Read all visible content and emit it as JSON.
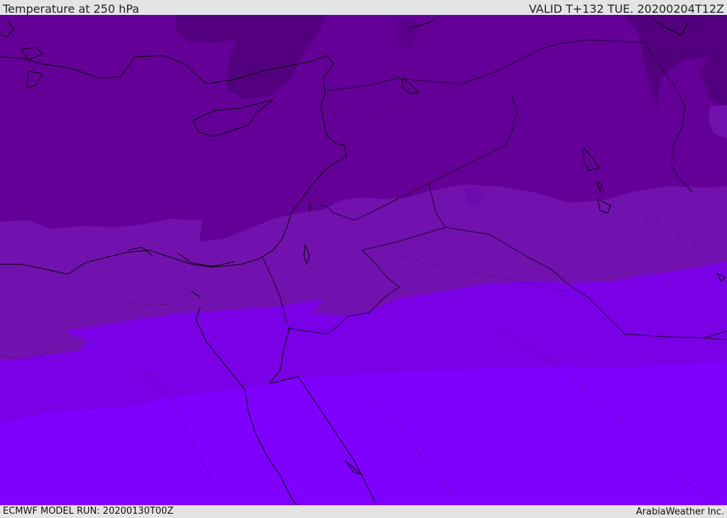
{
  "header": {
    "title": "Temperature at 250 hPa",
    "valid_time": "VALID T+132 TUE. 20200204T12Z"
  },
  "footer": {
    "model_run": "ECMWF MODEL RUN: 20200130T00Z",
    "credit": "ArabiaWeather Inc."
  },
  "map": {
    "region": "Eastern Mediterranean / Middle East",
    "field": "temperature",
    "colors": {
      "coldest": "#520082",
      "cold": "#620096",
      "mid": "#7212ae",
      "warm": "#7a00e6",
      "warmest": "#7f00ff",
      "coastline": "#000000",
      "border": "#1a0030"
    }
  }
}
